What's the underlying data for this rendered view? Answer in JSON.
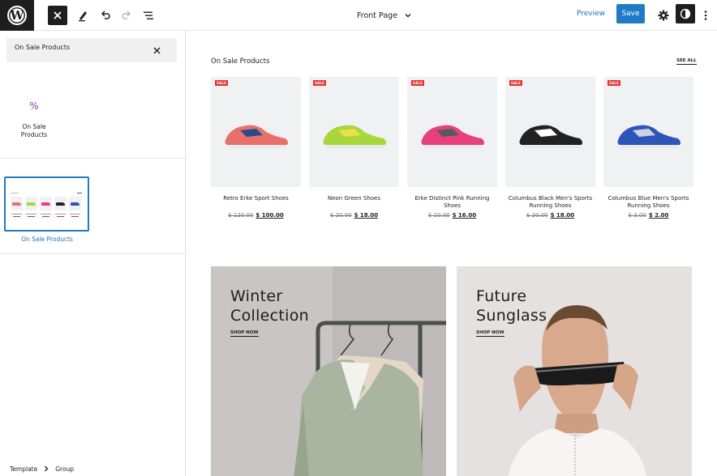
{
  "toolbar": {
    "document_title": "Front Page",
    "preview_label": "Preview",
    "save_label": "Save"
  },
  "sidebar": {
    "search": {
      "value": "On Sale Products",
      "placeholder": "Search"
    },
    "block": {
      "label": "On Sale Products",
      "icon": "percent-icon"
    },
    "pattern": {
      "label": "On Sale Products"
    }
  },
  "breadcrumb": [
    "Template",
    "Group"
  ],
  "canvas": {
    "section_title": "On Sale Products",
    "see_all": "SEE ALL",
    "products": [
      {
        "badge": "SALE",
        "name": "Retro Erke Sport Shoes",
        "old_price": "$ 120.00",
        "new_price": "$ 100.00",
        "color": "#e8706a",
        "accent": "#2b4a8c"
      },
      {
        "badge": "SALE",
        "name": "Neon Green Shoes",
        "old_price": "$ 20.00",
        "new_price": "$ 18.00",
        "color": "#a9d63a",
        "accent": "#e8e24a"
      },
      {
        "badge": "SALE",
        "name": "Erke Distinct Pink Running Shoes",
        "old_price": "$ 10.00",
        "new_price": "$ 16.00",
        "color": "#e8407a",
        "accent": "#555a66"
      },
      {
        "badge": "SALE",
        "name": "Columbus Black Men's Sports Running Shoes",
        "old_price": "$ 20.00",
        "new_price": "$ 18.00",
        "color": "#222222",
        "accent": "#ffffff"
      },
      {
        "badge": "SALE",
        "name": "Columbus Blue Men's Sports Running Shoes",
        "old_price": "$ 3.00",
        "new_price": "$ 2.00",
        "color": "#2e55b8",
        "accent": "#c9d3e8"
      }
    ],
    "banners": [
      {
        "title_line1": "Winter",
        "title_line2": "Collection",
        "cta": "SHOP NOW"
      },
      {
        "title_line1": "Future",
        "title_line2": "Sunglass",
        "cta": "SHOP NOW"
      }
    ]
  },
  "colors": {
    "accent": "#1f7bc6",
    "sale": "#e63232",
    "dark": "#1e1e1e"
  }
}
